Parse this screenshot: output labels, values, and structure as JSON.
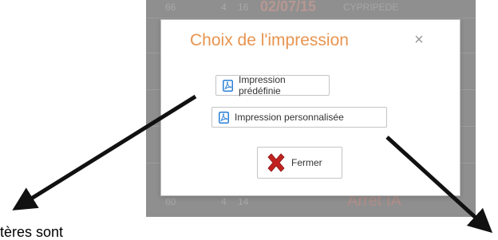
{
  "background_rows": [
    {
      "c1": "66",
      "c2": "4",
      "c3": "16",
      "date": "02/07/15",
      "name": "CYPRIPEDE",
      "status": ""
    },
    {
      "c1": "60",
      "c2": "4",
      "c3": "14",
      "date": "",
      "name": "",
      "status": "Arrêt IA"
    }
  ],
  "modal": {
    "title": "Choix de l'impression",
    "close_glyph": "×",
    "buttons": {
      "predefined": "Impression prédéfinie",
      "custom": "Impression personnalisée",
      "close": "Fermer"
    }
  },
  "caption": {
    "text": "tères sont"
  },
  "colors": {
    "title": "#e8944f",
    "pdf_icon": "#2b7fd6",
    "close_x": "#c0231f",
    "arrow": "#111111"
  },
  "icons": {
    "pdf": "pdf-icon",
    "close_x": "red-x-icon",
    "modal_close": "close-icon"
  }
}
